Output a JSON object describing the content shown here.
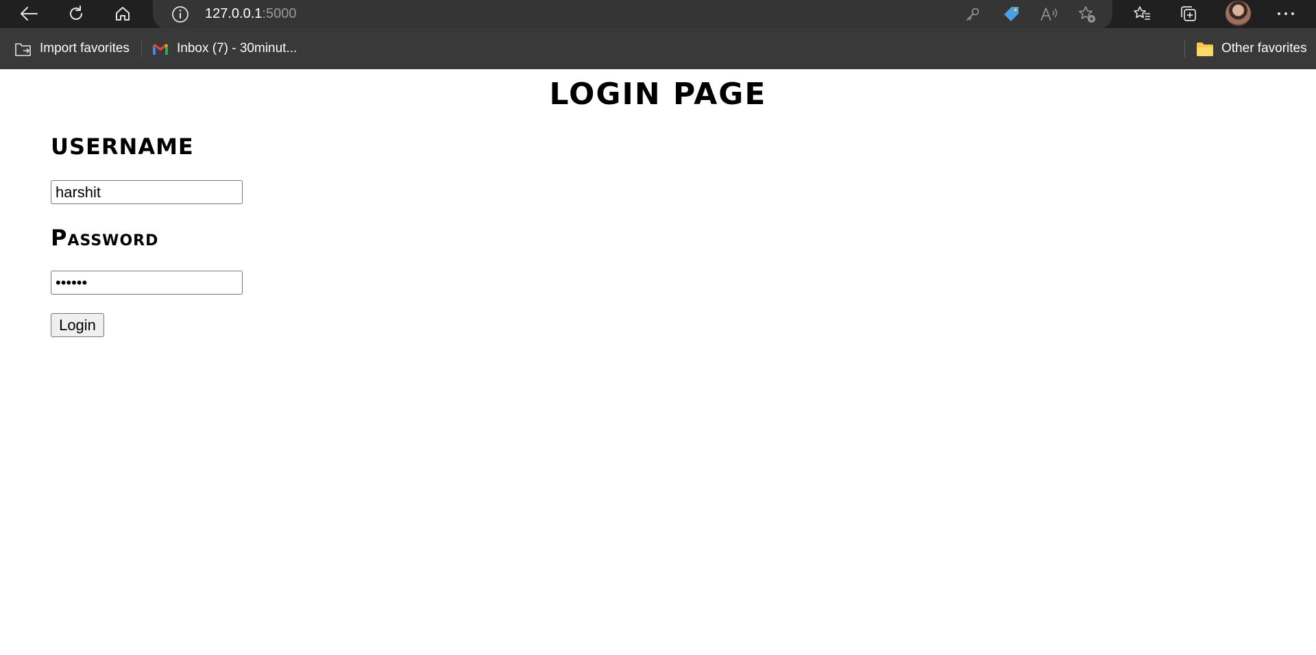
{
  "browser": {
    "url_host": "127.0.0.1",
    "url_port": ":5000",
    "favorites": {
      "import_label": "Import favorites",
      "gmail_label": "Inbox (7) - 30minut...",
      "other_label": "Other favorites"
    }
  },
  "page": {
    "title": "LOGIN PAGE",
    "username_label": "USERNAME",
    "username_value": "harshit",
    "password_label": "Password",
    "password_value": "harshi",
    "login_button": "Login"
  }
}
